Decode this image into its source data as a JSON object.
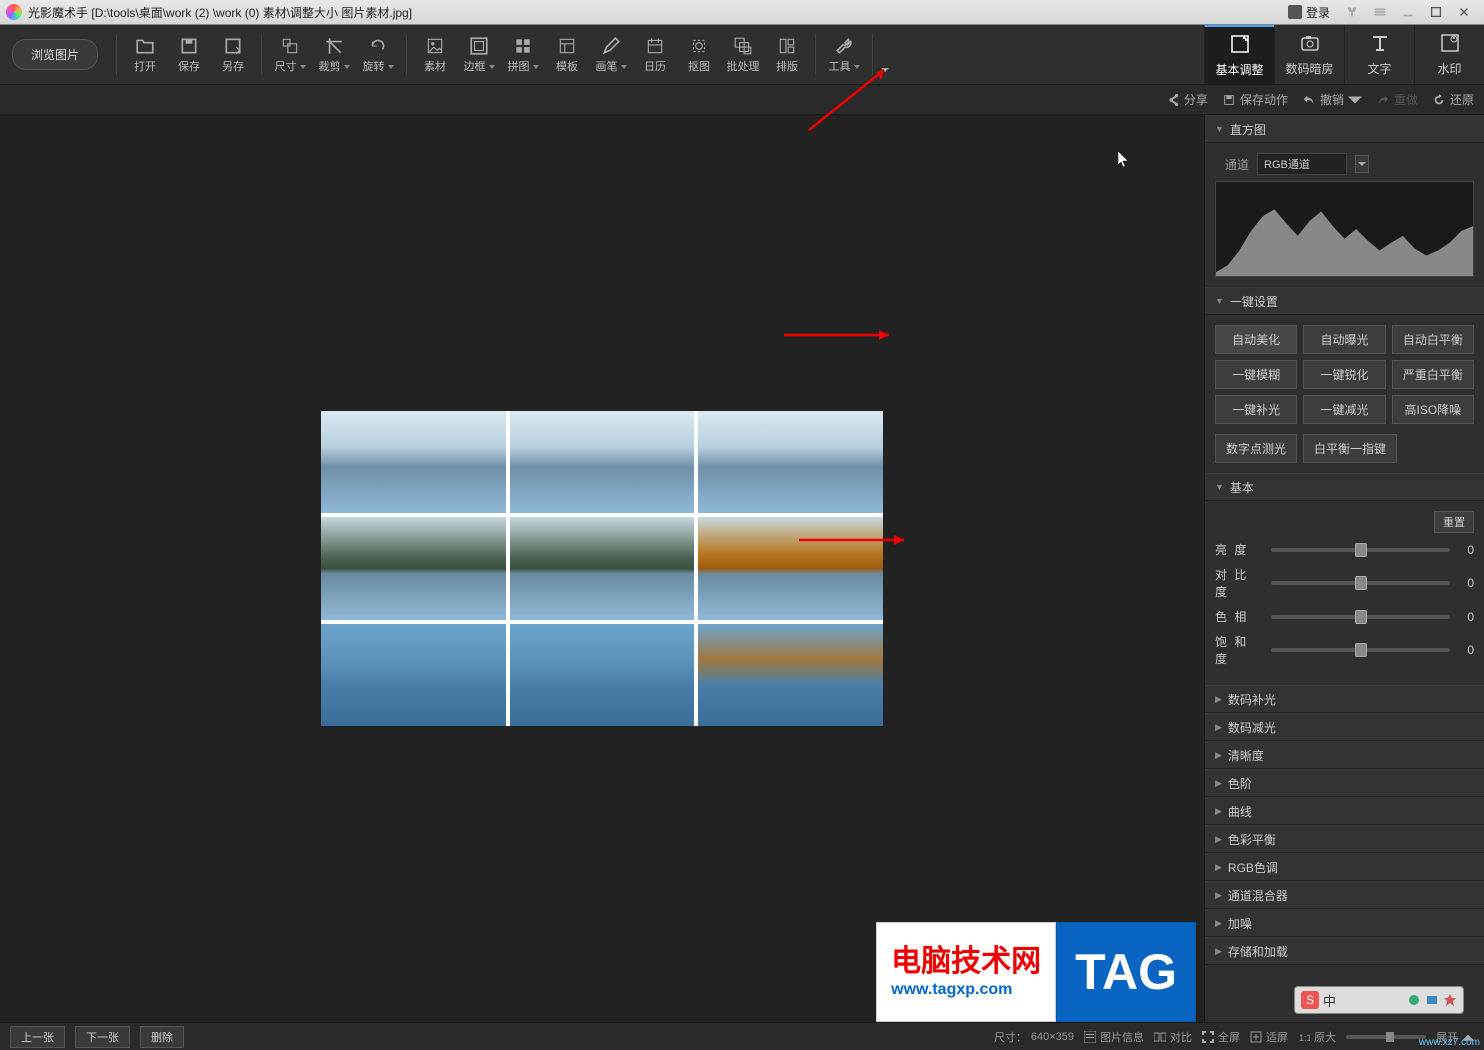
{
  "app": {
    "name": "光影魔术手",
    "file_path": "[D:\\tools\\桌面\\work (2) \\work (0) 素材\\调整大小 图片素材.jpg]"
  },
  "titlebar": {
    "login": "登录"
  },
  "toolbar": {
    "browse": "浏览图片",
    "items": [
      {
        "label": "打开"
      },
      {
        "label": "保存"
      },
      {
        "label": "另存"
      },
      {
        "label": "尺寸"
      },
      {
        "label": "裁剪"
      },
      {
        "label": "旋转"
      },
      {
        "label": "素材"
      },
      {
        "label": "边框"
      },
      {
        "label": "拼图"
      },
      {
        "label": "模板"
      },
      {
        "label": "画笔"
      },
      {
        "label": "日历"
      },
      {
        "label": "抠图"
      },
      {
        "label": "批处理"
      },
      {
        "label": "排版"
      },
      {
        "label": "工具"
      }
    ]
  },
  "right_tabs": [
    {
      "label": "基本调整",
      "active": true
    },
    {
      "label": "数码暗房",
      "active": false
    },
    {
      "label": "文字",
      "active": false
    },
    {
      "label": "水印",
      "active": false
    }
  ],
  "actionbar": {
    "share": "分享",
    "save_action": "保存动作",
    "undo": "撤销",
    "redo": "重做",
    "restore": "还原"
  },
  "panel": {
    "histogram": {
      "title": "直方图",
      "channel_label": "通道",
      "channel": "RGB通道"
    },
    "oneclick": {
      "title": "一键设置",
      "buttons": [
        "自动美化",
        "自动曝光",
        "自动白平衡",
        "一键模糊",
        "一键锐化",
        "严重白平衡",
        "一键补光",
        "一键减光",
        "高ISO降噪"
      ],
      "extras": [
        "数字点测光",
        "白平衡一指键"
      ]
    },
    "basic": {
      "title": "基本",
      "reset": "重置",
      "sliders": [
        {
          "name": "亮    度",
          "value": 0,
          "pos": 50
        },
        {
          "name": "对 比 度",
          "value": 0,
          "pos": 50
        },
        {
          "name": "色    相",
          "value": 0,
          "pos": 50
        },
        {
          "name": "饱 和 度",
          "value": 0,
          "pos": 50
        }
      ]
    },
    "collapsed": [
      "数码补光",
      "数码减光",
      "清晰度",
      "色阶",
      "曲线",
      "色彩平衡",
      "RGB色调",
      "通道混合器",
      "加噪",
      "存储和加载"
    ]
  },
  "bottom": {
    "prev": "上一张",
    "next": "下一张",
    "delete": "删除",
    "size_label": "尺寸：",
    "size": "640×359",
    "info": "图片信息",
    "compare": "对比",
    "fullscreen": "全屏",
    "fit": "适屏",
    "original": "原大",
    "expand": "展开"
  },
  "watermark": {
    "site_name": "电脑技术网",
    "site_url": "www.tagxp.com",
    "tag": "TAG",
    "corner": "www.xz7.com"
  }
}
